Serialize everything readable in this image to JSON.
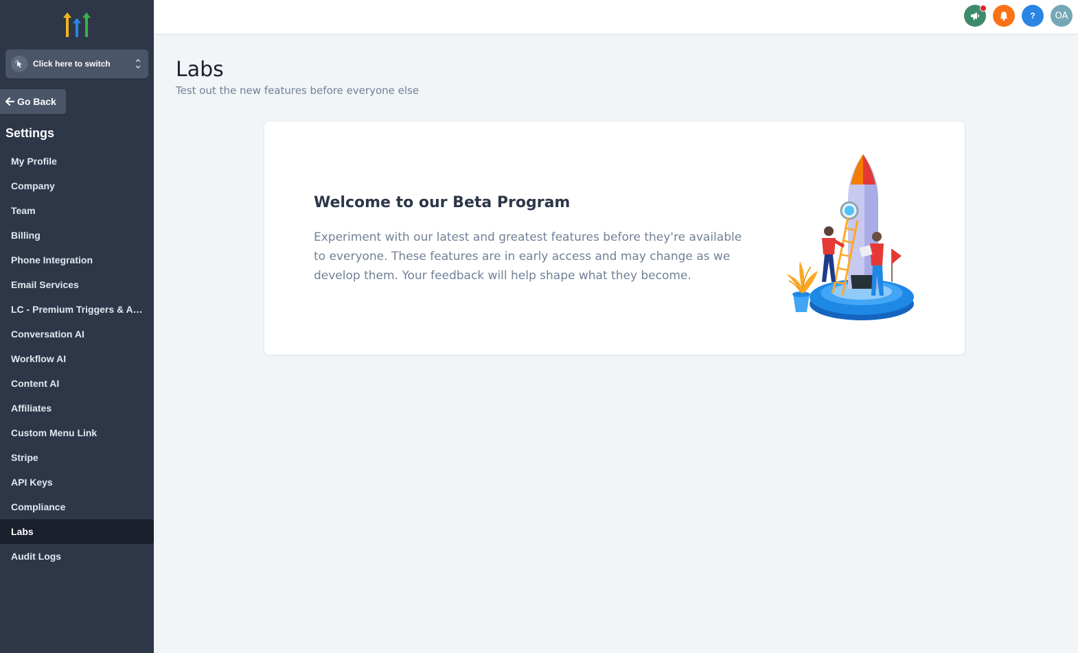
{
  "sidebar": {
    "switcher_label": "Click here to switch",
    "go_back_label": "Go Back",
    "section_title": "Settings",
    "items": [
      {
        "label": "My Profile",
        "active": false
      },
      {
        "label": "Company",
        "active": false
      },
      {
        "label": "Team",
        "active": false
      },
      {
        "label": "Billing",
        "active": false
      },
      {
        "label": "Phone Integration",
        "active": false
      },
      {
        "label": "Email Services",
        "active": false
      },
      {
        "label": "LC - Premium Triggers & Acti...",
        "active": false
      },
      {
        "label": "Conversation AI",
        "active": false
      },
      {
        "label": "Workflow AI",
        "active": false
      },
      {
        "label": "Content AI",
        "active": false
      },
      {
        "label": "Affiliates",
        "active": false
      },
      {
        "label": "Custom Menu Link",
        "active": false
      },
      {
        "label": "Stripe",
        "active": false
      },
      {
        "label": "API Keys",
        "active": false
      },
      {
        "label": "Compliance",
        "active": false
      },
      {
        "label": "Labs",
        "active": true
      },
      {
        "label": "Audit Logs",
        "active": false
      }
    ]
  },
  "header": {
    "icons": [
      "megaphone-icon",
      "bell-icon",
      "help-icon"
    ],
    "help_glyph": "?",
    "avatar_initials": "OA",
    "colors": {
      "announce": "#3d8b6d",
      "bell": "#f97316",
      "help": "#2b85e4",
      "avatar": "#75a8b5"
    }
  },
  "main": {
    "title": "Labs",
    "subtitle": "Test out the new features before everyone else",
    "card": {
      "title": "Welcome to our Beta Program",
      "text": "Experiment with our latest and greatest features before they're available to everyone. These features are in early access and may change as we develop them. Your feedback will help shape what they become."
    }
  },
  "theme": {
    "sidebar_bg": "#2d3748",
    "sidebar_active_bg": "#1a202c",
    "page_bg": "#f1f5f8"
  }
}
